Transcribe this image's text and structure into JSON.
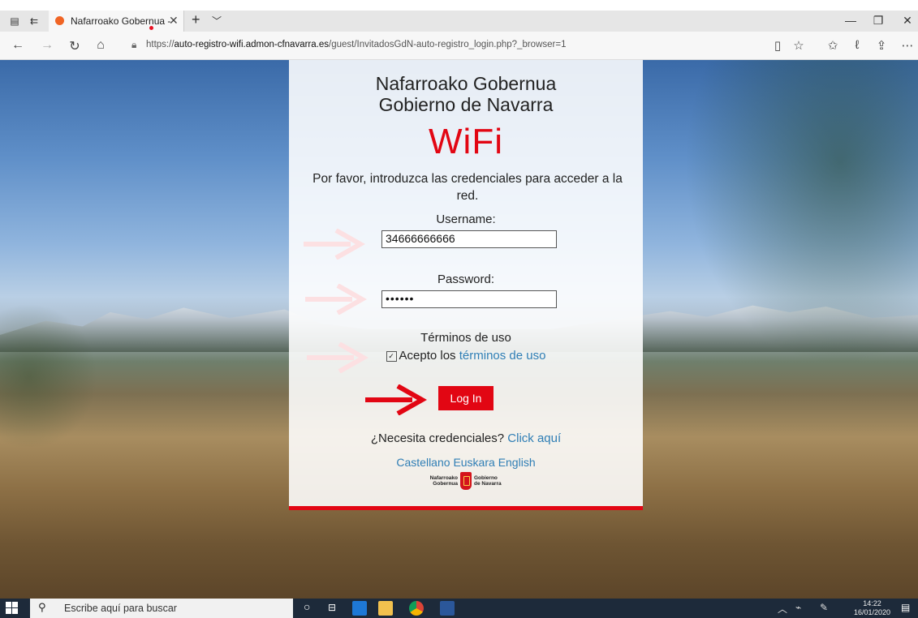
{
  "browser": {
    "tab_title": "Nafarroako Gobernua -",
    "url_prefix": "https://",
    "url_host": "auto-registro-wifi.admon-cfnavarra.es",
    "url_path": "/guest/InvitadosGdN-auto-registro_login.php?_browser=1"
  },
  "page": {
    "brand_line1": "Nafarroako Gobernua",
    "brand_line2": "Gobierno de Navarra",
    "wifi_title": "WiFi",
    "intro": "Por favor, introduzca las credenciales para acceder a la red.",
    "username_label": "Username:",
    "username_value": "34666666666",
    "password_label": "Password:",
    "password_value": "••••••",
    "terms_heading": "Términos de uso",
    "accept_text": "Acepto los",
    "terms_link": "términos de uso",
    "login_label": "Log In",
    "need_text": "¿Necesita credenciales?",
    "click_here": "Click aquí",
    "languages": [
      "Castellano",
      "Euskara",
      "English"
    ],
    "logo": {
      "left_line1": "Nafarroako",
      "left_line2": "Gobernua",
      "right_line1": "Gobierno",
      "right_line2": "de Navarra"
    },
    "accent_color": "#e20613",
    "link_color": "#2f7eb5"
  },
  "taskbar": {
    "search_placeholder": "Escribe aquí para buscar",
    "time": "14:22",
    "date": "16/01/2020"
  }
}
